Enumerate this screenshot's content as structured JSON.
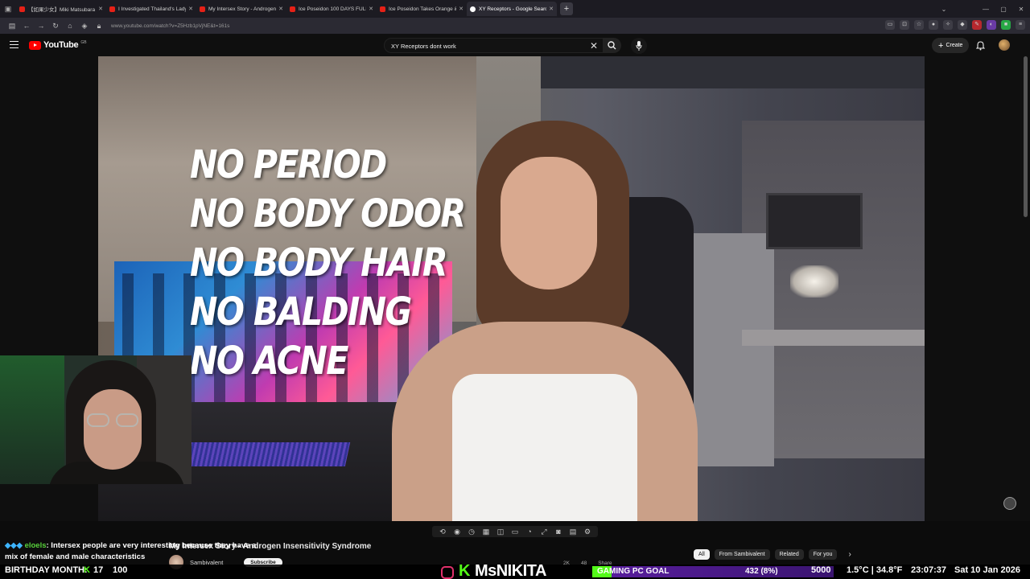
{
  "browser": {
    "tabs": [
      {
        "title": "【如果少女】Miki Matsubara 'S",
        "icon": "youtube-icon",
        "active": false
      },
      {
        "title": "I Investigated Thailand's Ladyb",
        "icon": "youtube-icon",
        "active": false
      },
      {
        "title": "My Intersex Story - Androgen I",
        "icon": "youtube-icon",
        "active": false
      },
      {
        "title": "Ice Poseidon 100 DAYS FULL V",
        "icon": "youtube-icon",
        "active": false
      },
      {
        "title": "Ice Poseidon Takes Orange & P",
        "icon": "youtube-icon",
        "active": false
      },
      {
        "title": "XY Receptors - Google Search",
        "icon": "google-icon",
        "active": true
      }
    ],
    "new_tab": "+",
    "url": "www.youtube.com/watch?v=Z5Hzb1pVjNE&t=161s"
  },
  "youtube": {
    "logo_text": "YouTube",
    "logo_sup": "GB",
    "search_query": "XY Receptors dont work",
    "create_label": "Create"
  },
  "video": {
    "overlay_lines": [
      "NO PERIOD",
      "NO BODY ODOR",
      "NO BODY HAIR",
      "NO BALDING",
      "NO ACNE"
    ]
  },
  "below_video": {
    "title": "My Intersex Story - Androgen Insensitivity Syndrome",
    "channel": "Sambivalent",
    "subscribe_label": "Subscribe",
    "chips": [
      "All",
      "From Sambivalent",
      "Related",
      "For you"
    ],
    "mini": [
      "2K",
      "48",
      "Share"
    ]
  },
  "stream": {
    "chat": {
      "user": "eloels",
      "message": ": Intersex people are very interesting because they have a mix of female and male characteristics"
    },
    "ticker": {
      "left": "BIRTHDAY MONTH: ",
      "k_count": "17",
      "hundred": "100",
      "brand": "MsNIKITA",
      "goal_label": "GAMING PC GOAL",
      "goal_value": "432 (8%)",
      "goal_fraction": 0.08,
      "goal_target": "5000",
      "weather": "1.5°C | 34.8°F",
      "time": "23:07:37",
      "date": "Sat 10 Jan 2026"
    }
  },
  "colors": {
    "accent": "#ff0000",
    "kick_green": "#53fc18"
  }
}
